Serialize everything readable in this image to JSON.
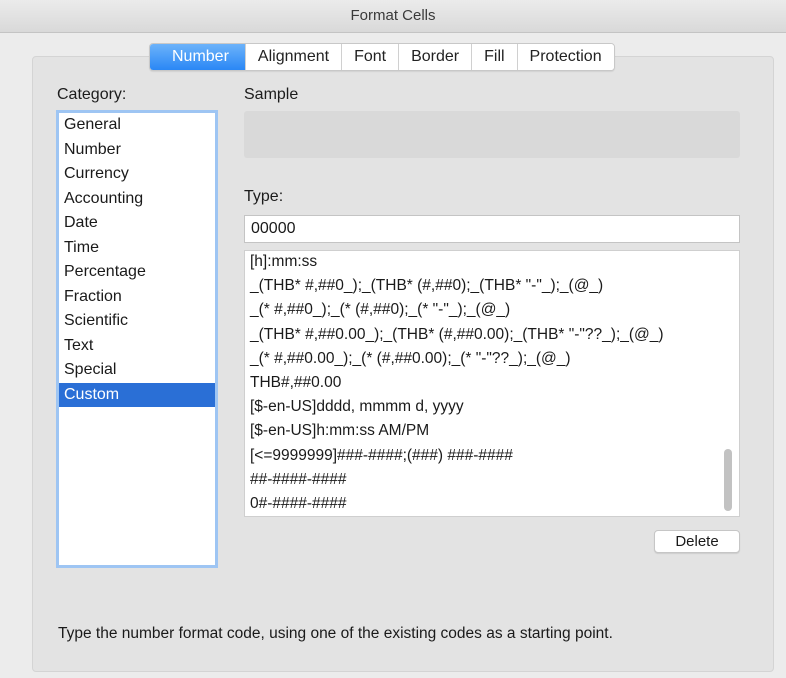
{
  "window": {
    "title": "Format Cells"
  },
  "tabs": [
    {
      "label": "Number",
      "active": true
    },
    {
      "label": "Alignment",
      "active": false
    },
    {
      "label": "Font",
      "active": false
    },
    {
      "label": "Border",
      "active": false
    },
    {
      "label": "Fill",
      "active": false
    },
    {
      "label": "Protection",
      "active": false
    }
  ],
  "category": {
    "label": "Category:",
    "items": [
      "General",
      "Number",
      "Currency",
      "Accounting",
      "Date",
      "Time",
      "Percentage",
      "Fraction",
      "Scientific",
      "Text",
      "Special",
      "Custom"
    ],
    "selected": "Custom"
  },
  "sample": {
    "label": "Sample",
    "value": ""
  },
  "type": {
    "label": "Type:",
    "value": "00000",
    "codes": [
      "[h]:mm:ss",
      "_(THB* #,##0_);_(THB* (#,##0);_(THB* \"-\"_);_(@_)",
      "_(* #,##0_);_(* (#,##0);_(* \"-\"_);_(@_)",
      "_(THB* #,##0.00_);_(THB* (#,##0.00);_(THB* \"-\"??_);_(@_)",
      "_(* #,##0.00_);_(* (#,##0.00);_(* \"-\"??_);_(@_)",
      "THB#,##0.00",
      "[$-en-US]dddd, mmmm d, yyyy",
      "[$-en-US]h:mm:ss AM/PM",
      "[<=9999999]###-####;(###) ###-####",
      "##-####-####",
      "0#-####-####"
    ]
  },
  "delete_label": "Delete",
  "hint": "Type the number format code, using one of the existing codes as a starting point.",
  "colors": {
    "accent": "#2a87f5",
    "selection": "#2a6fd6",
    "focus_ring": "#9ec5f3"
  }
}
